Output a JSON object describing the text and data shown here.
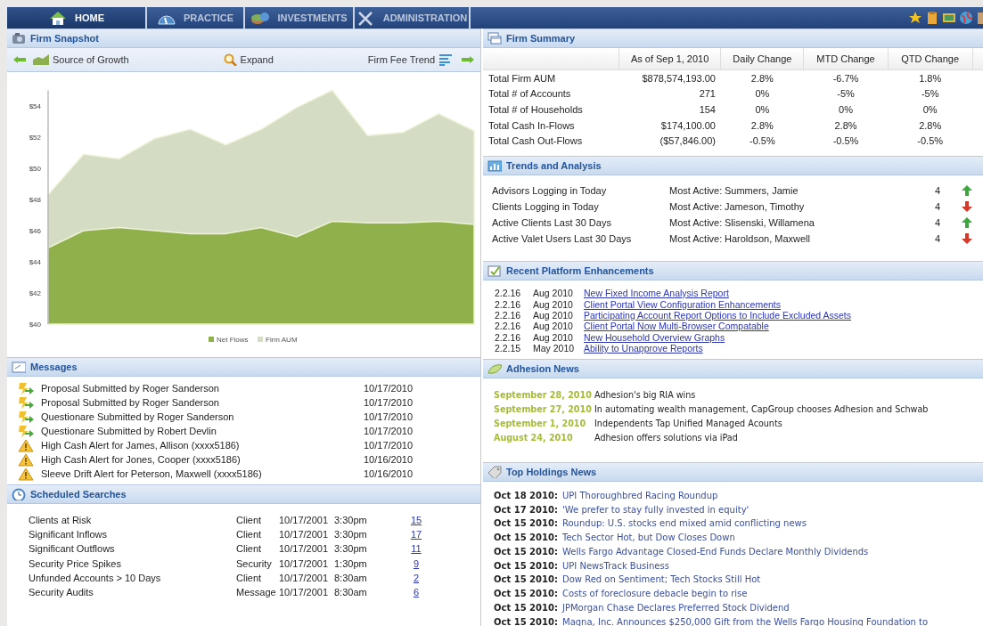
{
  "nav": {
    "tabs": [
      {
        "label": "HOME",
        "selected": true
      },
      {
        "label": "PRACTICE",
        "selected": false
      },
      {
        "label": "INVESTMENTS",
        "selected": false
      },
      {
        "label": "ADMINISTRATION",
        "selected": false
      }
    ]
  },
  "firm_snapshot": {
    "title": "Firm Snapshot",
    "toolbar": {
      "back_label": "Source of Growth",
      "expand_label": "Expand",
      "forward_label": "Firm Fee Trend"
    },
    "chart_data": {
      "type": "area",
      "ylim": [
        40,
        55
      ],
      "yticks": [
        {
          "value": 40,
          "label": "$40"
        },
        {
          "value": 42,
          "label": "$42"
        },
        {
          "value": 44,
          "label": "$44"
        },
        {
          "value": 46,
          "label": "$46"
        },
        {
          "value": 48,
          "label": "$48"
        },
        {
          "value": 50,
          "label": "$50"
        },
        {
          "value": 52,
          "label": "$52"
        },
        {
          "value": 54,
          "label": "$54"
        }
      ],
      "series": [
        {
          "name": "Net Flows",
          "color": "#8fb04a",
          "values": [
            44.9,
            46.0,
            46.2,
            46.0,
            45.8,
            45.8,
            46.2,
            45.6,
            46.6,
            46.5,
            46.5,
            46.6,
            46.4
          ]
        },
        {
          "name": "Firm AUM",
          "color": "#d5dcc4",
          "values": [
            48.3,
            50.9,
            50.6,
            51.9,
            52.5,
            51.5,
            52.5,
            53.9,
            55.0,
            52.1,
            52.3,
            53.5,
            52.4
          ]
        }
      ]
    }
  },
  "messages": {
    "title": "Messages",
    "items": [
      {
        "kind": "proposal",
        "text": "Proposal Submitted by Roger Sanderson",
        "date": "10/17/2010"
      },
      {
        "kind": "proposal",
        "text": "Proposal Submitted by Roger Sanderson",
        "date": "10/17/2010"
      },
      {
        "kind": "proposal",
        "text": "Questionare Submitted by Roger Sanderson",
        "date": "10/17/2010"
      },
      {
        "kind": "proposal",
        "text": "Questionare Submitted by Robert Devlin",
        "date": "10/17/2010"
      },
      {
        "kind": "alert",
        "text": "High Cash Alert for James, Allison (xxxx5186)",
        "date": "10/17/2010"
      },
      {
        "kind": "alert",
        "text": "High Cash Alert for Jones, Cooper (xxxx5186)",
        "date": "10/16/2010"
      },
      {
        "kind": "alert",
        "text": "Sleeve Drift Alert for Peterson, Maxwell (xxxx5186)",
        "date": "10/16/2010"
      }
    ]
  },
  "scheduled_searches": {
    "title": "Scheduled Searches",
    "rows": [
      {
        "name": "Clients at Risk",
        "type": "Client",
        "date": "10/17/2001",
        "time": "3:30pm",
        "count": "15"
      },
      {
        "name": "Significant Inflows",
        "type": "Client",
        "date": "10/17/2001",
        "time": "3:30pm",
        "count": "17"
      },
      {
        "name": "Significant Outflows",
        "type": "Client",
        "date": "10/17/2001",
        "time": "3:30pm",
        "count": "11"
      },
      {
        "name": "Security Price Spikes",
        "type": "Security",
        "date": "10/17/2001",
        "time": "1:30pm",
        "count": "9"
      },
      {
        "name": "Unfunded Accounts > 10 Days",
        "type": "Client",
        "date": "10/17/2001",
        "time": "8:30am",
        "count": "2"
      },
      {
        "name": "Security Audits",
        "type": "Message",
        "date": "10/17/2001",
        "time": "8:30am",
        "count": "6"
      }
    ]
  },
  "firm_summary": {
    "title": "Firm Summary",
    "columns": [
      "As of Sep 1, 2010",
      "Daily Change",
      "MTD Change",
      "QTD Change"
    ],
    "rows": [
      {
        "label": "Total Firm AUM",
        "values": [
          "$878,574,193.00",
          "2.8%",
          "-6.7%",
          "1.8%"
        ]
      },
      {
        "label": "Total # of Accounts",
        "values": [
          "271",
          "0%",
          "-5%",
          "-5%"
        ]
      },
      {
        "label": "Total # of Households",
        "values": [
          "154",
          "0%",
          "0%",
          "0%"
        ]
      },
      {
        "label": "Total Cash In-Flows",
        "values": [
          "$174,100.00",
          "2.8%",
          "2.8%",
          "2.8%"
        ]
      },
      {
        "label": "Total Cash Out-Flows",
        "values": [
          "($57,846.00)",
          "-0.5%",
          "-0.5%",
          "-0.5%"
        ]
      }
    ]
  },
  "trends": {
    "title": "Trends and Analysis",
    "rows": [
      {
        "label": "Advisors Logging in Today",
        "most_active_label": "Most Active:",
        "name": "Summers, Jamie",
        "count": "4",
        "kind": "up"
      },
      {
        "label": "Clients Logging in Today",
        "most_active_label": "Most Active:",
        "name": "Jameson, Timothy",
        "count": "4",
        "kind": "down"
      },
      {
        "label": "Active Clients Last 30 Days",
        "most_active_label": "Most Active:",
        "name": "Slisenski, Willamena",
        "count": "4",
        "kind": "up"
      },
      {
        "label": "Active Valet Users Last 30 Days",
        "most_active_label": "Most Active:",
        "name": "Haroldson, Maxwell",
        "count": "4",
        "kind": "down"
      }
    ]
  },
  "enhancements": {
    "title": "Recent Platform Enhancements",
    "items": [
      {
        "version": "2.2.16",
        "date": "Aug 2010",
        "link": "New Fixed Income Analysis Report"
      },
      {
        "version": "2.2.16",
        "date": "Aug 2010",
        "link": "Client Portal View Configuration Enhancements"
      },
      {
        "version": "2.2.16",
        "date": "Aug 2010",
        "link": "Participating Account Report Options to Include Excluded Assets"
      },
      {
        "version": "2.2.16",
        "date": "Aug 2010",
        "link": "Client Portal Now Multi-Browser Compatable"
      },
      {
        "version": "2.2.16",
        "date": "Aug 2010",
        "link": "New Household Overview Graphs"
      },
      {
        "version": "2.2.15",
        "date": "May 2010",
        "link": "Ability to Unapprove Reports"
      }
    ]
  },
  "adhesion_news": {
    "title": "Adhesion News",
    "items": [
      {
        "date": "September 28, 2010",
        "headline": "Adhesion's big RIA wins"
      },
      {
        "date": "September 27, 2010",
        "headline": "In automating wealth management, CapGroup chooses Adhesion and Schwab"
      },
      {
        "date": "September 1, 2010",
        "headline": "Independents Tap Unified Managed Acounts"
      },
      {
        "date": "August 24, 2010",
        "headline": "Adhesion offers solutions via iPad"
      }
    ]
  },
  "top_holdings_news": {
    "title": "Top Holdings News",
    "items": [
      {
        "date": "Oct 18 2010:",
        "headline": "UPI Thoroughbred Racing Roundup"
      },
      {
        "date": "Oct 17 2010:",
        "headline": "'We prefer to stay fully invested in equity'"
      },
      {
        "date": "Oct 15 2010:",
        "headline": "Roundup: U.S. stocks end mixed amid conflicting news"
      },
      {
        "date": "Oct 15 2010:",
        "headline": "Tech Sector Hot, but Dow Closes Down"
      },
      {
        "date": "Oct 15 2010:",
        "headline": "Wells Fargo Advantage Closed-End Funds Declare Monthly Dividends"
      },
      {
        "date": "Oct 15 2010:",
        "headline": "UPI NewsTrack Business"
      },
      {
        "date": "Oct 15 2010:",
        "headline": "Dow Red on Sentiment; Tech Stocks Still Hot"
      },
      {
        "date": "Oct 15 2010:",
        "headline": "Costs of foreclosure debacle begin to rise"
      },
      {
        "date": "Oct 15 2010:",
        "headline": "JPMorgan Chase Declares Preferred Stock Dividend"
      },
      {
        "date": "Oct 15 2010:",
        "headline": "Magna, Inc. Announces $250,000 Gift from the Wells Fargo Housing Foundation to"
      }
    ]
  }
}
